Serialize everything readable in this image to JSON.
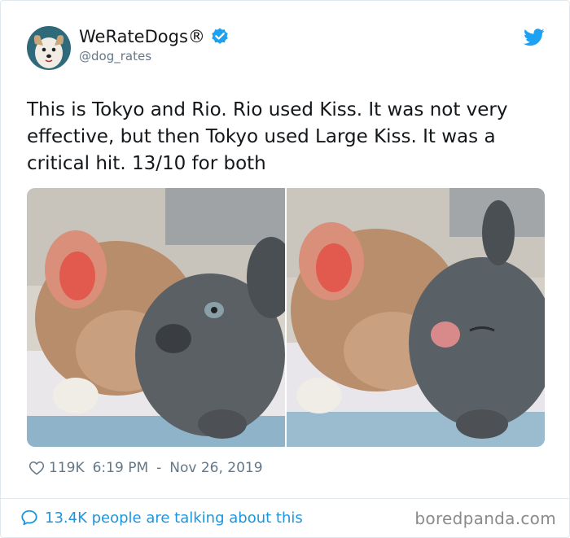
{
  "author": {
    "name": "WeRateDogs®",
    "handle": "@dog_rates",
    "verified_icon": "verified-badge-icon",
    "brand_color": "#1da1f2"
  },
  "tweet": {
    "text": "This is Tokyo and Rio. Rio used Kiss. It was not very effective, but then Tokyo used Large Kiss. It was a critical hit. 13/10 for both",
    "images": [
      {
        "alt": "Two French bulldog puppies, tan and grey, nose to nose"
      },
      {
        "alt": "Two French bulldog puppies kissing, grey pup with eyes closed"
      }
    ]
  },
  "meta": {
    "likes": "119K",
    "time": "6:19 PM",
    "separator": "-",
    "date": "Nov 26, 2019"
  },
  "footer": {
    "conversation_text": "13.4K people are talking about this",
    "watermark": "boredpanda.com"
  }
}
